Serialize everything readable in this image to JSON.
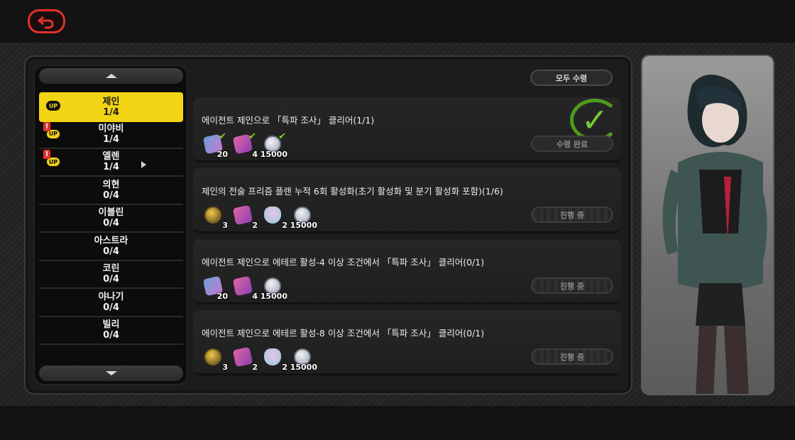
{
  "header": {
    "back_icon": "back-arrow-icon"
  },
  "colors": {
    "accent": "#f2d414",
    "danger": "#e0322b",
    "complete": "#78c43a"
  },
  "agents": [
    {
      "name": "제인",
      "progress": "1/4",
      "up": true,
      "alert": false,
      "active": true
    },
    {
      "name": "미야비",
      "progress": "1/4",
      "up": true,
      "alert": true,
      "active": false
    },
    {
      "name": "엘렌",
      "progress": "1/4",
      "up": true,
      "alert": true,
      "active": false
    },
    {
      "name": "의현",
      "progress": "0/4",
      "up": false,
      "alert": false,
      "active": false
    },
    {
      "name": "이블린",
      "progress": "0/4",
      "up": false,
      "alert": false,
      "active": false
    },
    {
      "name": "아스트라",
      "progress": "0/4",
      "up": false,
      "alert": false,
      "active": false
    },
    {
      "name": "코린",
      "progress": "0/4",
      "up": false,
      "alert": false,
      "active": false
    },
    {
      "name": "야나기",
      "progress": "0/4",
      "up": false,
      "alert": false,
      "active": false
    },
    {
      "name": "빌리",
      "progress": "0/4",
      "up": false,
      "alert": false,
      "active": false
    }
  ],
  "badges": {
    "up_label": "UP",
    "alert_label": "!"
  },
  "claim_all_label": "모두 수령",
  "missions": [
    {
      "title": "에이전트 제인으로 「특파 조사」 클리어(1/1)",
      "status": "수령 완료",
      "completed": true,
      "rewards": [
        {
          "icon": "ticket-icon",
          "qty": "20",
          "claimed": true
        },
        {
          "icon": "card-icon",
          "qty": "4",
          "claimed": true
        },
        {
          "icon": "coin-icon",
          "qty": "15000",
          "claimed": true
        }
      ]
    },
    {
      "title": "제인의 전술 프리즘 플랜 누적 6회 활성화(초기 활성화 및 분기 활성화 포함)(1/6)",
      "status": "진행 중",
      "completed": false,
      "rewards": [
        {
          "icon": "star-medal-icon",
          "qty": "3"
        },
        {
          "icon": "card-icon",
          "qty": "2"
        },
        {
          "icon": "potion-icon",
          "qty": "2"
        },
        {
          "icon": "coin-icon",
          "qty": "15000"
        }
      ]
    },
    {
      "title": "에이전트 제인으로 에테르 활성-4 이상 조건에서 「특파 조사」 클리어(0/1)",
      "status": "진행 중",
      "completed": false,
      "rewards": [
        {
          "icon": "ticket-icon",
          "qty": "20"
        },
        {
          "icon": "card-icon",
          "qty": "4"
        },
        {
          "icon": "coin-icon",
          "qty": "15000"
        }
      ]
    },
    {
      "title": "에이전트 제인으로 에테르 활성-8 이상 조건에서 「특파 조사」 클리어(0/1)",
      "status": "진행 중",
      "completed": false,
      "rewards": [
        {
          "icon": "star-medal-icon",
          "qty": "3"
        },
        {
          "icon": "card-icon",
          "qty": "2"
        },
        {
          "icon": "potion-icon",
          "qty": "2"
        },
        {
          "icon": "coin-icon",
          "qty": "15000"
        }
      ]
    }
  ],
  "portrait": {
    "icon": "agent-portrait-jane"
  }
}
